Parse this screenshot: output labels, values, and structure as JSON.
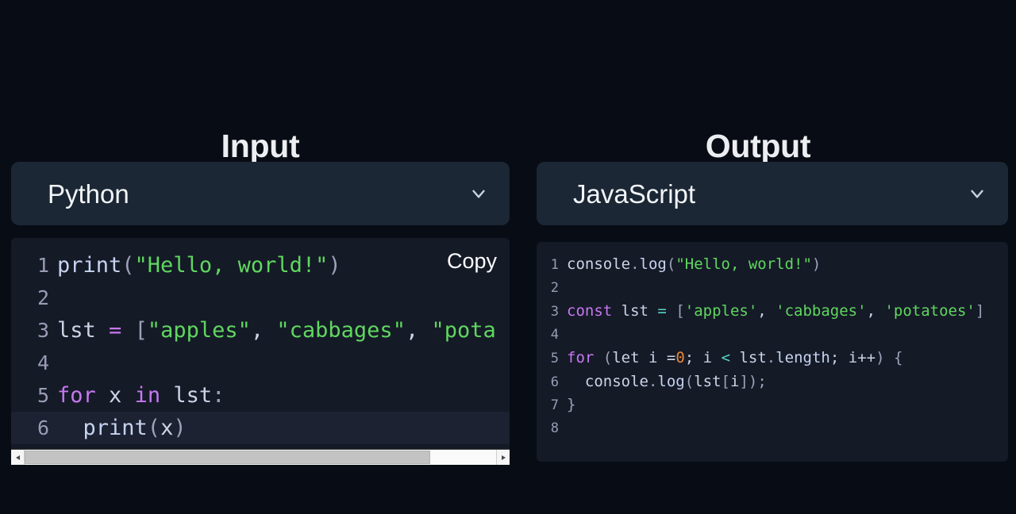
{
  "theme": {
    "page_background": "#080c14",
    "panel_background": "#1b2735",
    "code_background": "#151a27",
    "active_line_background": "#1c2232",
    "text_primary": "#eceef2",
    "line_number_color": "#9b9bb5",
    "token_keyword": "#c678f0",
    "token_string": "#5fd75f",
    "token_number": "#e8883a",
    "token_operator": "#56d4c6",
    "token_plain": "#ccd4e6",
    "token_punctuation": "#9aa3b8",
    "scrollbar_thumb": "#c3c3c3"
  },
  "input_pane": {
    "title": "Input",
    "language_select": {
      "value": "Python",
      "chevron_icon": "chevron-down-icon"
    },
    "copy_button_label": "Copy",
    "scrollbar": {
      "left_arrow_icon": "arrow-left-icon",
      "right_arrow_icon": "arrow-right-icon",
      "thumb_width_percent": 86
    },
    "code": {
      "language": "python",
      "active_line": 6,
      "lines": [
        {
          "number": "1",
          "tokens": [
            {
              "text": "print",
              "type": "fn"
            },
            {
              "text": "(",
              "type": "punc"
            },
            {
              "text": "\"Hello, world!\"",
              "type": "str"
            },
            {
              "text": ")",
              "type": "punc"
            }
          ]
        },
        {
          "number": "2",
          "tokens": []
        },
        {
          "number": "3",
          "tokens": [
            {
              "text": "lst ",
              "type": "plain"
            },
            {
              "text": "=",
              "type": "kw"
            },
            {
              "text": " ",
              "type": "plain"
            },
            {
              "text": "[",
              "type": "punc"
            },
            {
              "text": "\"apples\"",
              "type": "str"
            },
            {
              "text": ", ",
              "type": "plain"
            },
            {
              "text": "\"cabbages\"",
              "type": "str"
            },
            {
              "text": ", ",
              "type": "plain"
            },
            {
              "text": "\"pota",
              "type": "str"
            }
          ]
        },
        {
          "number": "4",
          "tokens": []
        },
        {
          "number": "5",
          "tokens": [
            {
              "text": "for",
              "type": "kw"
            },
            {
              "text": " x ",
              "type": "plain"
            },
            {
              "text": "in",
              "type": "kw"
            },
            {
              "text": " lst",
              "type": "plain"
            },
            {
              "text": ":",
              "type": "punc"
            }
          ]
        },
        {
          "number": "6",
          "tokens": [
            {
              "text": "  ",
              "type": "plain"
            },
            {
              "text": "print",
              "type": "fn"
            },
            {
              "text": "(",
              "type": "punc"
            },
            {
              "text": "x",
              "type": "plain"
            },
            {
              "text": ")",
              "type": "punc"
            }
          ]
        }
      ],
      "full_text": "print(\"Hello, world!\")\n\nlst = [\"apples\", \"cabbages\", \"potatoes\"]\n\nfor x in lst:\n  print(x)"
    }
  },
  "output_pane": {
    "title": "Output",
    "language_select": {
      "value": "JavaScript",
      "chevron_icon": "chevron-down-icon"
    },
    "code": {
      "language": "javascript",
      "active_line": null,
      "lines": [
        {
          "number": "1",
          "tokens": [
            {
              "text": "console",
              "type": "plain"
            },
            {
              "text": ".",
              "type": "punc"
            },
            {
              "text": "log",
              "type": "prop"
            },
            {
              "text": "(",
              "type": "punc"
            },
            {
              "text": "\"Hello, world!\"",
              "type": "str"
            },
            {
              "text": ")",
              "type": "punc"
            }
          ]
        },
        {
          "number": "2",
          "tokens": []
        },
        {
          "number": "3",
          "tokens": [
            {
              "text": "const",
              "type": "kw"
            },
            {
              "text": " lst ",
              "type": "plain"
            },
            {
              "text": "=",
              "type": "op"
            },
            {
              "text": " ",
              "type": "plain"
            },
            {
              "text": "[",
              "type": "punc"
            },
            {
              "text": "'apples'",
              "type": "str"
            },
            {
              "text": ", ",
              "type": "plain"
            },
            {
              "text": "'cabbages'",
              "type": "str"
            },
            {
              "text": ", ",
              "type": "plain"
            },
            {
              "text": "'potatoes'",
              "type": "str"
            },
            {
              "text": "]",
              "type": "punc"
            }
          ]
        },
        {
          "number": "4",
          "tokens": []
        },
        {
          "number": "5",
          "tokens": [
            {
              "text": "for",
              "type": "kw"
            },
            {
              "text": " ",
              "type": "plain"
            },
            {
              "text": "(",
              "type": "punc"
            },
            {
              "text": "let",
              "type": "plain"
            },
            {
              "text": " i ",
              "type": "plain"
            },
            {
              "text": "=",
              "type": "plain"
            },
            {
              "text": "0",
              "type": "num"
            },
            {
              "text": "; i ",
              "type": "plain"
            },
            {
              "text": "<",
              "type": "op"
            },
            {
              "text": " lst",
              "type": "plain"
            },
            {
              "text": ".",
              "type": "punc"
            },
            {
              "text": "length",
              "type": "prop"
            },
            {
              "text": "; i",
              "type": "plain"
            },
            {
              "text": "++",
              "type": "plain"
            },
            {
              "text": ")",
              "type": "punc"
            },
            {
              "text": " ",
              "type": "plain"
            },
            {
              "text": "{",
              "type": "punc"
            }
          ]
        },
        {
          "number": "6",
          "tokens": [
            {
              "text": "  ",
              "type": "plain"
            },
            {
              "text": "console",
              "type": "plain"
            },
            {
              "text": ".",
              "type": "punc"
            },
            {
              "text": "log",
              "type": "prop"
            },
            {
              "text": "(",
              "type": "punc"
            },
            {
              "text": "lst",
              "type": "plain"
            },
            {
              "text": "[",
              "type": "punc"
            },
            {
              "text": "i",
              "type": "plain"
            },
            {
              "text": "]",
              "type": "punc"
            },
            {
              "text": ")",
              "type": "punc"
            },
            {
              "text": ";",
              "type": "punc"
            }
          ]
        },
        {
          "number": "7",
          "tokens": [
            {
              "text": "}",
              "type": "punc"
            }
          ]
        },
        {
          "number": "8",
          "tokens": []
        }
      ],
      "full_text": "console.log(\"Hello, world!\")\n\nconst lst = ['apples', 'cabbages', 'potatoes']\n\nfor (let i =0; i < lst.length; i++) {\n  console.log(lst[i]);\n}\n"
    }
  }
}
